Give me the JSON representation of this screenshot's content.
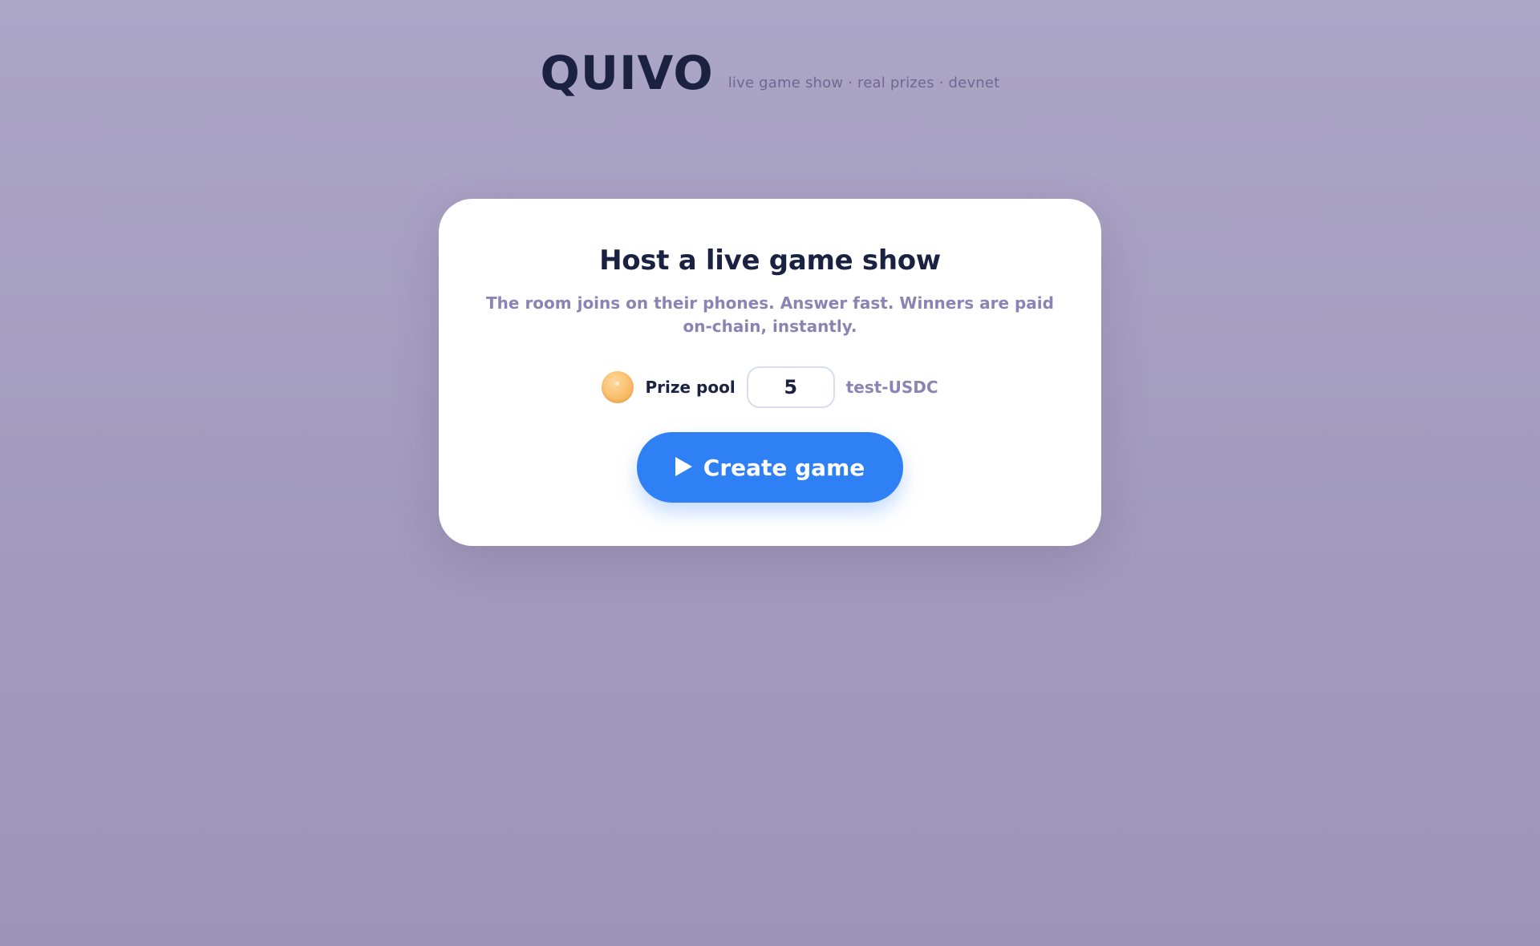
{
  "header": {
    "logo_text": "QUIVO",
    "tagline": "live game show · real prizes · devnet"
  },
  "card": {
    "title": "Host a live game show",
    "subtitle": "The room joins on their phones. Answer fast. Winners are paid on-chain, instantly.",
    "prize_pool": {
      "icon": "coin-icon",
      "label": "Prize pool",
      "value": "5",
      "unit": "test-USDC"
    },
    "create_button": {
      "icon": "play-icon",
      "label": "Create game"
    }
  },
  "colors": {
    "background": "#a7a0c2",
    "card": "#ffffff",
    "text_dark": "#1b2140",
    "text_muted": "#8a84b4",
    "accent_blue": "#2f80f4",
    "coin": "#f9bd6a"
  }
}
